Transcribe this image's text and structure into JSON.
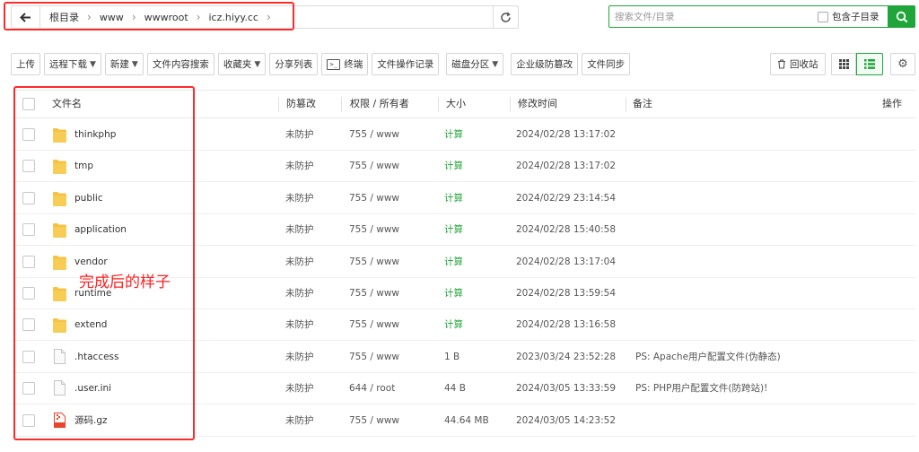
{
  "pathbar": {
    "crumbs": [
      "根目录",
      "www",
      "wwwroot",
      "icz.hiyy.cc"
    ]
  },
  "search": {
    "placeholder": "搜索文件/目录",
    "include_subdir_label": "包含子目录"
  },
  "toolbar": {
    "upload": "上传",
    "remote_download": "远程下载",
    "new": "新建",
    "content_search": "文件内容搜索",
    "favorites": "收藏夹",
    "share_list": "分享列表",
    "terminal": "终端",
    "operation_log": "文件操作记录",
    "disk_partition": "磁盘分区",
    "tamper_proof": "企业级防篡改",
    "file_sync": "文件同步",
    "recycle_bin": "回收站"
  },
  "table": {
    "headers": {
      "name": "文件名",
      "tamper": "防篡改",
      "perm_owner": "权限 / 所有者",
      "size": "大小",
      "mtime": "修改时间",
      "remark": "备注",
      "ops": "操作"
    },
    "rows": [
      {
        "name": "thinkphp",
        "type": "folder",
        "tamper": "未防护",
        "perm": "755 / www",
        "size": "计算",
        "mtime": "2024/02/28 13:17:02",
        "remark": ""
      },
      {
        "name": "tmp",
        "type": "folder",
        "tamper": "未防护",
        "perm": "755 / www",
        "size": "计算",
        "mtime": "2024/02/28 13:17:02",
        "remark": ""
      },
      {
        "name": "public",
        "type": "folder",
        "tamper": "未防护",
        "perm": "755 / www",
        "size": "计算",
        "mtime": "2024/02/29 23:14:54",
        "remark": ""
      },
      {
        "name": "application",
        "type": "folder",
        "tamper": "未防护",
        "perm": "755 / www",
        "size": "计算",
        "mtime": "2024/02/28 15:40:58",
        "remark": ""
      },
      {
        "name": "vendor",
        "type": "folder",
        "tamper": "未防护",
        "perm": "755 / www",
        "size": "计算",
        "mtime": "2024/02/28 13:17:04",
        "remark": ""
      },
      {
        "name": "runtime",
        "type": "folder",
        "tamper": "未防护",
        "perm": "755 / www",
        "size": "计算",
        "mtime": "2024/02/28 13:59:54",
        "remark": ""
      },
      {
        "name": "extend",
        "type": "folder",
        "tamper": "未防护",
        "perm": "755 / www",
        "size": "计算",
        "mtime": "2024/02/28 13:16:58",
        "remark": ""
      },
      {
        "name": ".htaccess",
        "type": "file",
        "tamper": "未防护",
        "perm": "755 / www",
        "size": "1 B",
        "mtime": "2023/03/24 23:52:28",
        "remark": "PS: Apache用户配置文件(伪静态)"
      },
      {
        "name": ".user.ini",
        "type": "file",
        "tamper": "未防护",
        "perm": "644 / root",
        "size": "44 B",
        "mtime": "2024/03/05 13:33:59",
        "remark": "PS: PHP用户配置文件(防跨站)!"
      },
      {
        "name": "源码.gz",
        "type": "archive",
        "tamper": "未防护",
        "perm": "755 / www",
        "size": "44.64 MB",
        "mtime": "2024/03/05 14:23:52",
        "remark": ""
      }
    ]
  },
  "annotation": "完成后的样子",
  "colors": {
    "accent": "#20a53a",
    "highlight": "#ff2a2a",
    "folder": "#f5c243",
    "archive": "#e8452c"
  }
}
